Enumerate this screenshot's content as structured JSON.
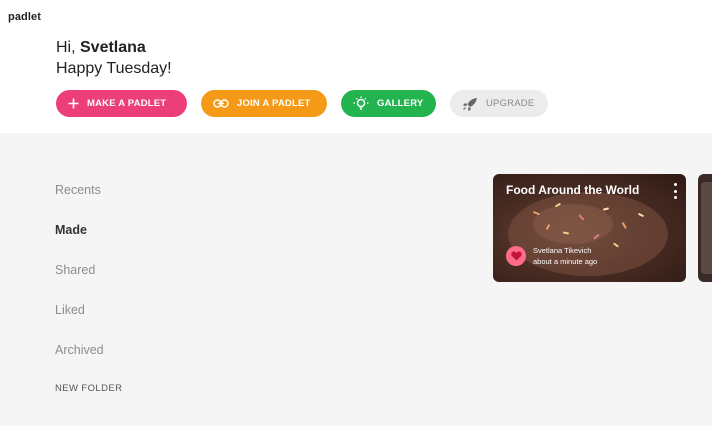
{
  "app": {
    "logo": "padlet"
  },
  "greeting": {
    "hi": "Hi, ",
    "name": "Svetlana",
    "day": "Happy Tuesday!"
  },
  "actions": {
    "make": "MAKE A PADLET",
    "join": "JOIN A PADLET",
    "gallery": "GALLERY",
    "upgrade": "UPGRADE"
  },
  "sidebar": {
    "items": [
      {
        "label": "Recents",
        "active": false
      },
      {
        "label": "Made",
        "active": true
      },
      {
        "label": "Shared",
        "active": false
      },
      {
        "label": "Liked",
        "active": false
      },
      {
        "label": "Archived",
        "active": false
      }
    ],
    "new_folder": "NEW FOLDER"
  },
  "cards": [
    {
      "title": "Food Around the World",
      "author": "Svetlana Tikevich",
      "time": "about a minute ago"
    }
  ],
  "colors": {
    "make": "#ec3f78",
    "join": "#f59a16",
    "gallery": "#23b34f",
    "upgrade_bg": "#ececec",
    "main_bg": "#f5f5f5"
  },
  "icons": {
    "make": "plus-icon",
    "join": "link-icon",
    "gallery": "lightbulb-icon",
    "upgrade": "rocket-icon",
    "card_menu": "more-vertical-icon",
    "avatar": "heart-icon"
  }
}
